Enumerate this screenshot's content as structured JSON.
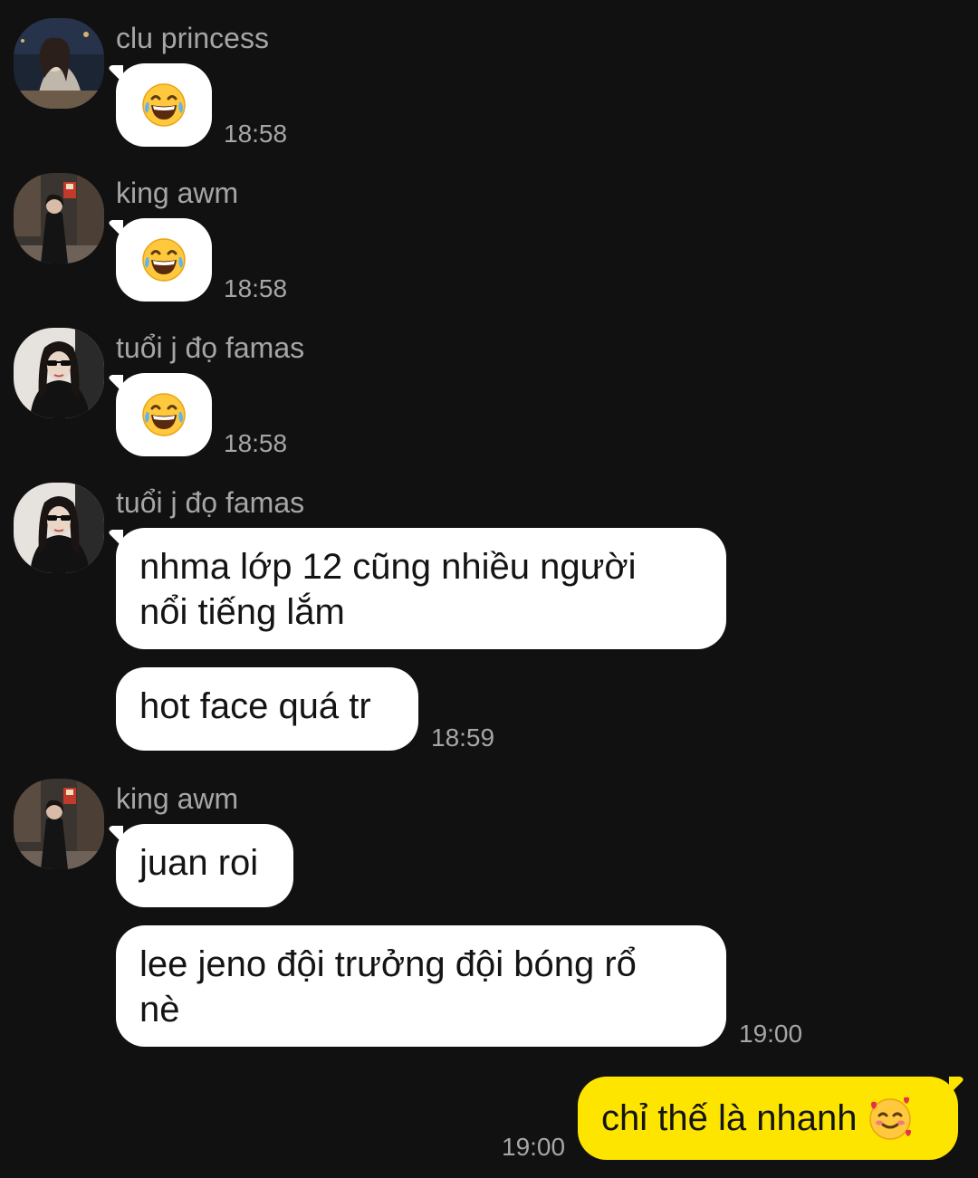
{
  "messages": [
    {
      "sender": "clu princess",
      "avatar": "avatar-clu-princess",
      "content": "laughing-tears-emoji",
      "time": "18:58"
    },
    {
      "sender": "king awm",
      "avatar": "avatar-king-awm",
      "content": "laughing-tears-emoji",
      "time": "18:58"
    },
    {
      "sender": "tuổi j đọ famas",
      "avatar": "avatar-tuoi-j-do-famas",
      "content": "laughing-tears-emoji",
      "time": "18:58"
    },
    {
      "sender": "tuổi j đọ famas",
      "avatar": "avatar-tuoi-j-do-famas",
      "lines": [
        "nhma lớp 12 cũng nhiều người",
        "nổi tiếng lắm"
      ],
      "text2": "hot face quá tr",
      "time": "18:59"
    },
    {
      "sender": "king awm",
      "avatar": "avatar-king-awm",
      "text1": "juan roi",
      "lines": [
        "lee jeno đội trưởng đội bóng rổ",
        "nè"
      ],
      "time": "19:00"
    }
  ],
  "my_message": {
    "text": "chỉ thế là nhanh",
    "emoji": "smiling-face-with-hearts-emoji",
    "time": "19:00"
  },
  "colors": {
    "background": "#111112",
    "incoming_bubble": "#ffffff",
    "outgoing_bubble": "#fee500",
    "meta_text": "#a6a6a8"
  }
}
